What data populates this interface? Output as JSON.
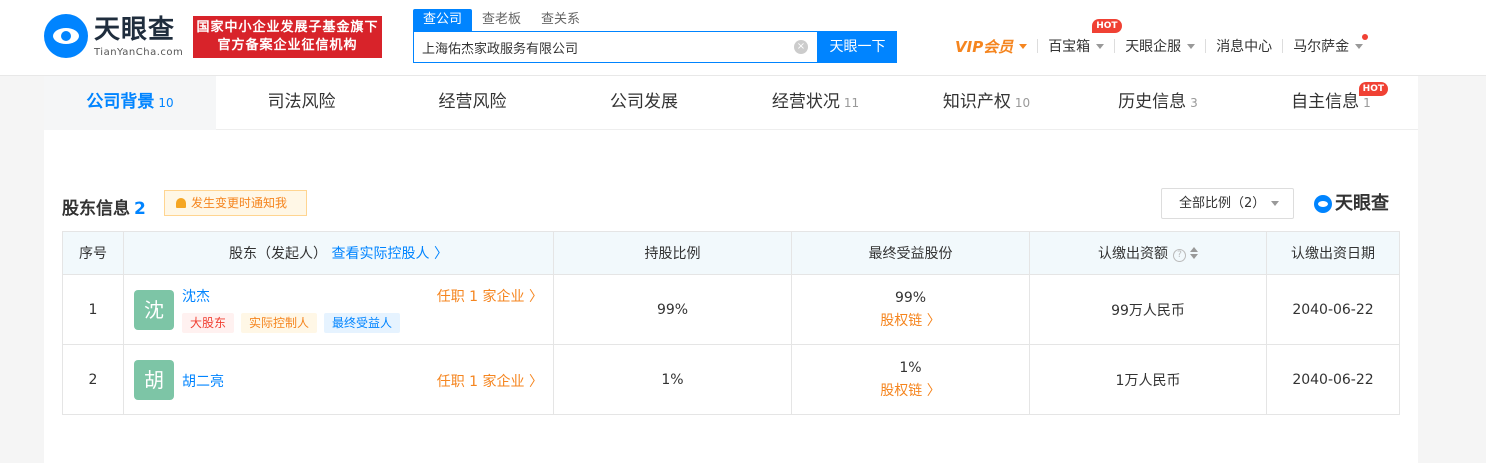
{
  "header": {
    "logo_cn": "天眼查",
    "logo_en": "TianYanCha.com",
    "banner_line1": "国家中小企业发展子基金旗下",
    "banner_line2": "官方备案企业征信机构",
    "search_tabs": [
      "查公司",
      "查老板",
      "查关系"
    ],
    "search_value": "上海佑杰家政服务有限公司",
    "search_button": "天眼一下",
    "clear_icon": "×",
    "nav": {
      "vip": "VIP会员",
      "toolbox": "百宝箱",
      "toolbox_badge": "HOT",
      "enterprise": "天眼企服",
      "messages": "消息中心",
      "user": "马尔萨金"
    }
  },
  "tabs": [
    {
      "label": "公司背景",
      "count": "10"
    },
    {
      "label": "司法风险",
      "count": ""
    },
    {
      "label": "经营风险",
      "count": ""
    },
    {
      "label": "公司发展",
      "count": ""
    },
    {
      "label": "经营状况",
      "count": "11"
    },
    {
      "label": "知识产权",
      "count": "10"
    },
    {
      "label": "历史信息",
      "count": "3"
    },
    {
      "label": "自主信息",
      "count": "1",
      "badge": "HOT"
    }
  ],
  "section": {
    "title": "股东信息",
    "count": "2",
    "notify_label": "发生变更时通知我",
    "ratio_select": "全部比例（2）",
    "watermark": "天眼查"
  },
  "table": {
    "headers": {
      "index": "序号",
      "holder": "股东（发起人）",
      "holder_link": "查看实际控股人",
      "ratio": "持股比例",
      "final": "最终受益股份",
      "amount": "认缴出资额",
      "date": "认缴出资日期"
    },
    "chain_label": "股权链",
    "rows": [
      {
        "index": "1",
        "avatar": "沈",
        "name": "沈杰",
        "post": "任职 1 家企业",
        "tags": [
          "大股东",
          "实际控制人",
          "最终受益人"
        ],
        "ratio": "99%",
        "final": "99%",
        "amount": "99万人民币",
        "date": "2040-06-22"
      },
      {
        "index": "2",
        "avatar": "胡",
        "name": "胡二亮",
        "post": "任职 1 家企业",
        "tags": [],
        "ratio": "1%",
        "final": "1%",
        "amount": "1万人民币",
        "date": "2040-06-22"
      }
    ]
  },
  "colors": {
    "brand": "#0084ff",
    "accent_orange": "#f5851f",
    "banner_red": "#d8232a",
    "hot_red": "#f04134",
    "avatar_green": "#7dc5a6"
  }
}
